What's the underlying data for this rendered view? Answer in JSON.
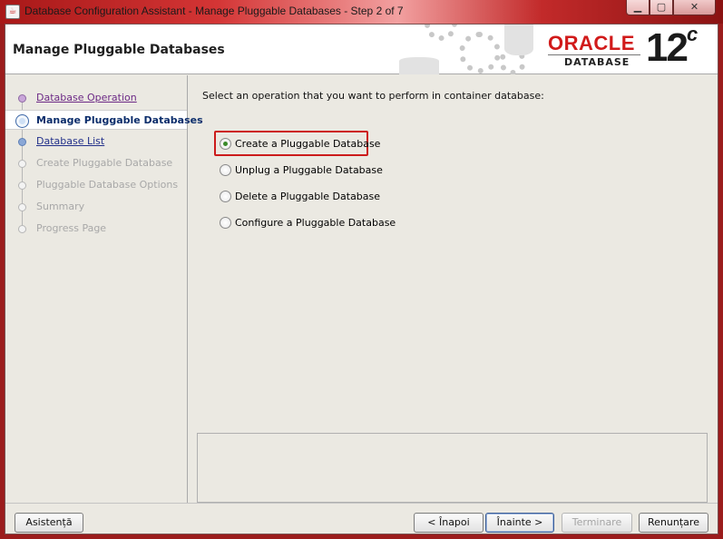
{
  "window": {
    "title": "Database Configuration Assistant - Manage Pluggable Databases - Step 2 of 7",
    "app_icon": "java-cup-icon"
  },
  "header": {
    "title": "Manage Pluggable Databases",
    "brand": "ORACLE",
    "brand_sub": "DATABASE",
    "version": "12",
    "version_suffix": "c",
    "brand_color": "#d11a1a"
  },
  "steps": [
    {
      "label": "Database Operation",
      "state": "visited"
    },
    {
      "label": "Manage Pluggable Databases",
      "state": "current"
    },
    {
      "label": "Database List",
      "state": "link"
    },
    {
      "label": "Create Pluggable Database",
      "state": "disabled"
    },
    {
      "label": "Pluggable Database Options",
      "state": "disabled"
    },
    {
      "label": "Summary",
      "state": "disabled"
    },
    {
      "label": "Progress Page",
      "state": "disabled"
    }
  ],
  "main": {
    "prompt": "Select an operation that you want to perform in container database:",
    "options": [
      {
        "label": "Create a Pluggable Database",
        "selected": true
      },
      {
        "label": "Unplug a Pluggable Database",
        "selected": false
      },
      {
        "label": "Delete a Pluggable Database",
        "selected": false
      },
      {
        "label": "Configure a Pluggable Database",
        "selected": false
      }
    ],
    "highlight_color": "#cc1b1b"
  },
  "footer": {
    "help": "Asistență",
    "back": "< Înapoi",
    "next": "Înainte >",
    "finish": "Terminare",
    "cancel": "Renunțare"
  }
}
